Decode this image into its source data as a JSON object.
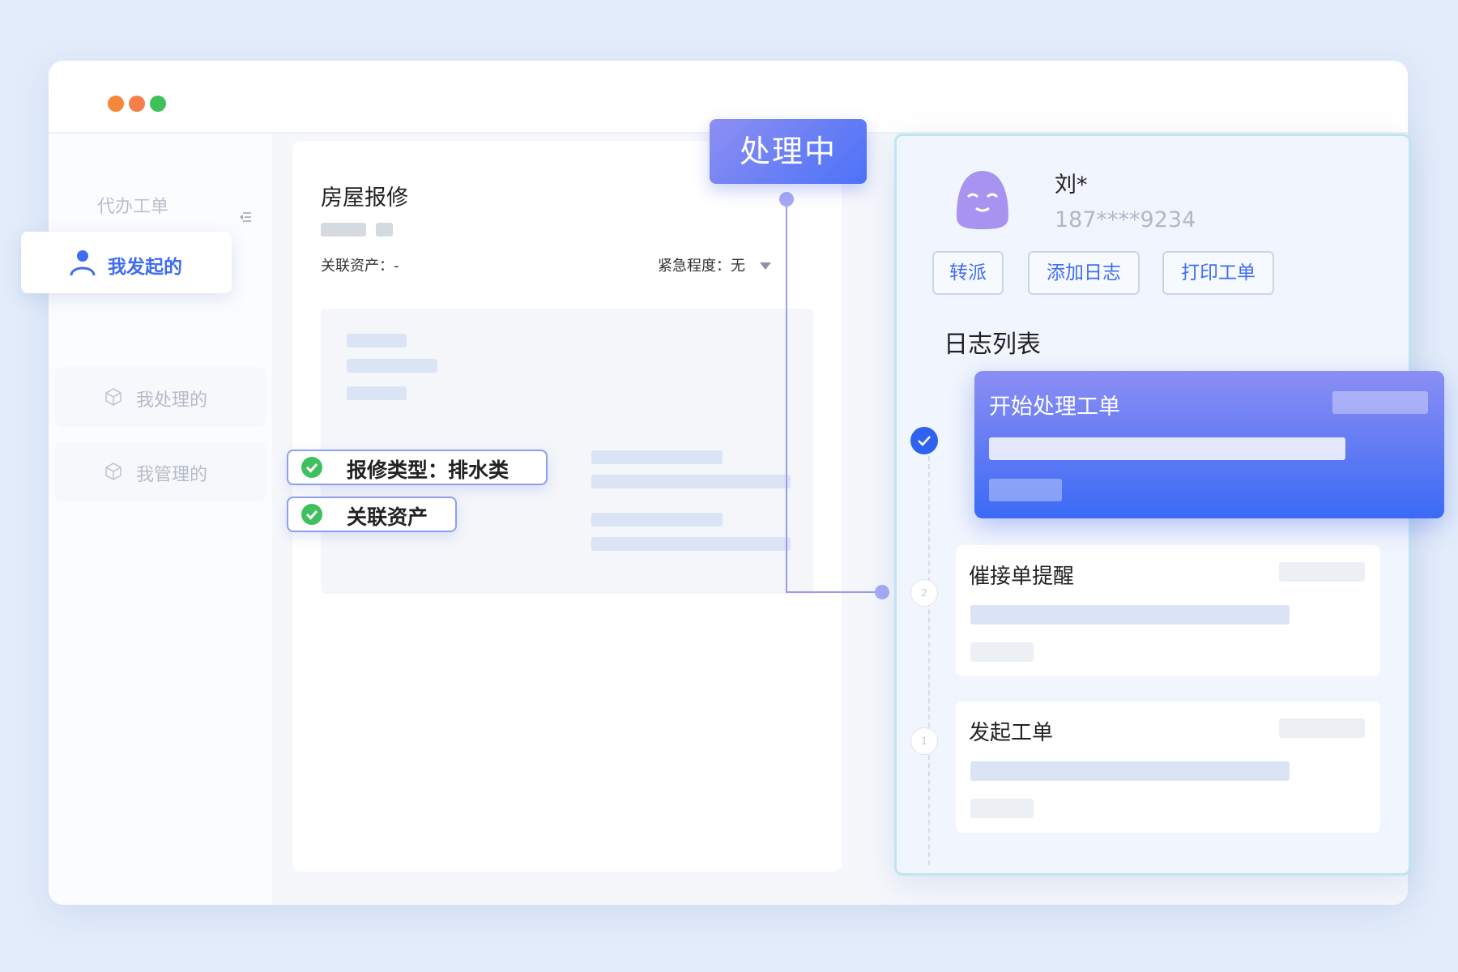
{
  "window": {
    "traffic_lights": {
      "colors": [
        "#f5873a",
        "#f47f4a",
        "#3fc05a"
      ]
    }
  },
  "sidebar": {
    "section_label": "代办工单",
    "items": [
      {
        "label": "我发起的",
        "active": true,
        "icon": "user-icon"
      },
      {
        "label": "我处理的",
        "active": false,
        "icon": "cube-icon"
      },
      {
        "label": "我管理的",
        "active": false,
        "icon": "cube-icon"
      }
    ]
  },
  "ticket": {
    "title": "房屋报修",
    "related_asset_field": "关联资产：-",
    "urgency_field": "紧急程度：无",
    "status": "处理中"
  },
  "checks": [
    {
      "label": "报修类型：排水类"
    },
    {
      "label": "关联资产"
    }
  ],
  "panel": {
    "user_name": "刘*",
    "user_phone": "187****9234",
    "buttons": [
      {
        "label": "转派"
      },
      {
        "label": "添加日志"
      },
      {
        "label": "打印工单"
      }
    ],
    "log_title": "日志列表",
    "logs": [
      {
        "label": "开始处理工单",
        "step": "",
        "active": true
      },
      {
        "label": "催接单提醒",
        "step": "2",
        "active": false
      },
      {
        "label": "发起工单",
        "step": "1",
        "active": false
      }
    ]
  },
  "colors": {
    "accent": "#3f6df0",
    "check_green": "#3ec15c",
    "status_gradient": [
      "#8d8ff2",
      "#4c72f7"
    ]
  }
}
